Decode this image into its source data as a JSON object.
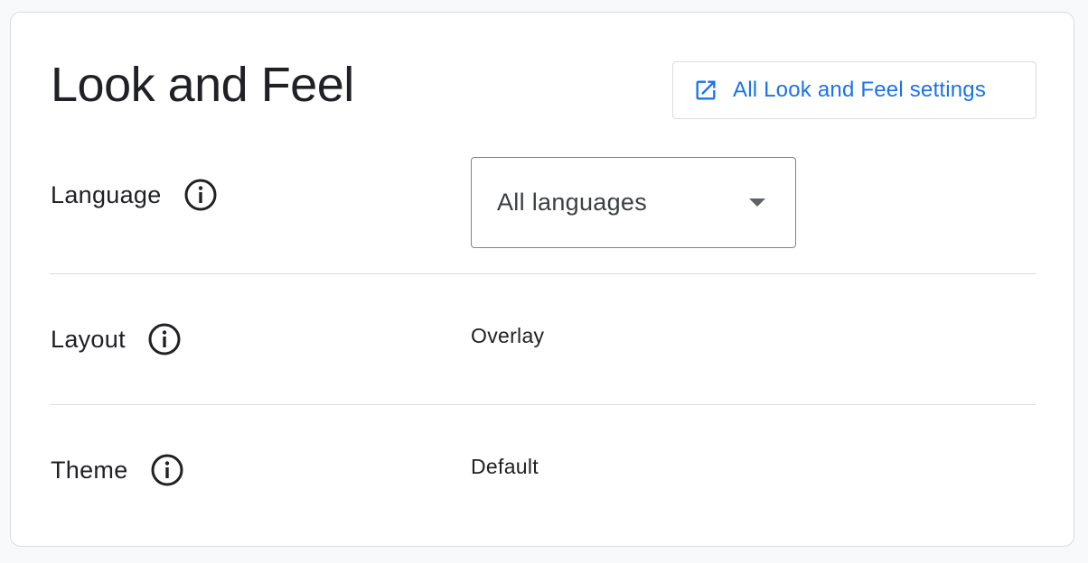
{
  "section": {
    "title": "Look and Feel",
    "all_settings_link": "All Look and Feel settings"
  },
  "rows": {
    "language": {
      "label": "Language",
      "value": "All languages"
    },
    "layout": {
      "label": "Layout",
      "value": "Overlay"
    },
    "theme": {
      "label": "Theme",
      "value": "Default"
    }
  },
  "icons": {
    "link": "open-in-new-icon",
    "info": "info-icon",
    "dropdown": "dropdown-arrow-icon"
  },
  "colors": {
    "accent": "#1a73e8",
    "text": "#202124",
    "border": "#dadce0"
  }
}
